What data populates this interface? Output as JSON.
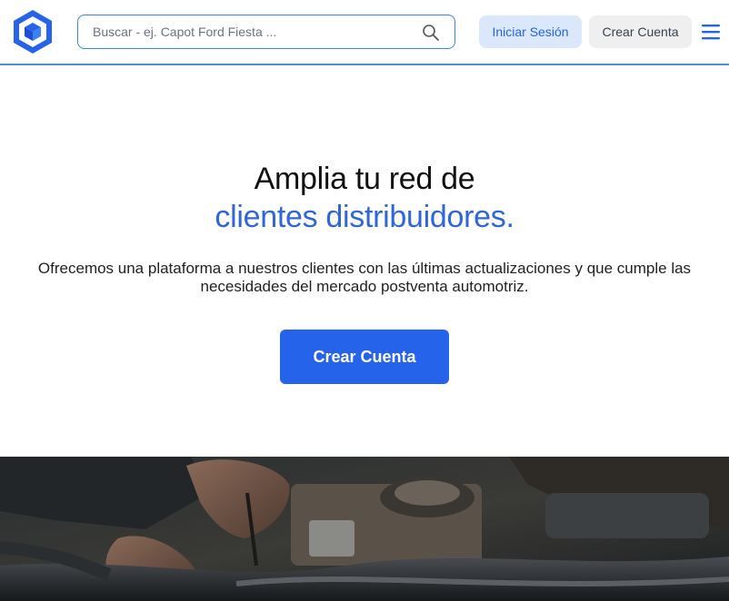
{
  "header": {
    "logo_icon": "cube-logo-icon",
    "search": {
      "placeholder": "Buscar - ej. Capot Ford Fiesta ...",
      "value": "",
      "icon": "search-icon"
    },
    "login_label": "Iniciar Sesión",
    "signup_label": "Crear Cuenta",
    "menu_icon": "hamburger-menu-icon"
  },
  "hero": {
    "title_line1": "Amplia tu red de",
    "title_line2": "clientes distribuidores.",
    "subtitle": "Ofrecemos una plataforma a nuestros clientes con las últimas actualizaciones y que cumple las necesidades del mercado postventa automotriz.",
    "cta_label": "Crear Cuenta"
  },
  "colors": {
    "accent": "#2563eb",
    "title_accent": "#2f66d8",
    "login_bg": "#dbe7fb",
    "signup_bg": "#efefef"
  }
}
